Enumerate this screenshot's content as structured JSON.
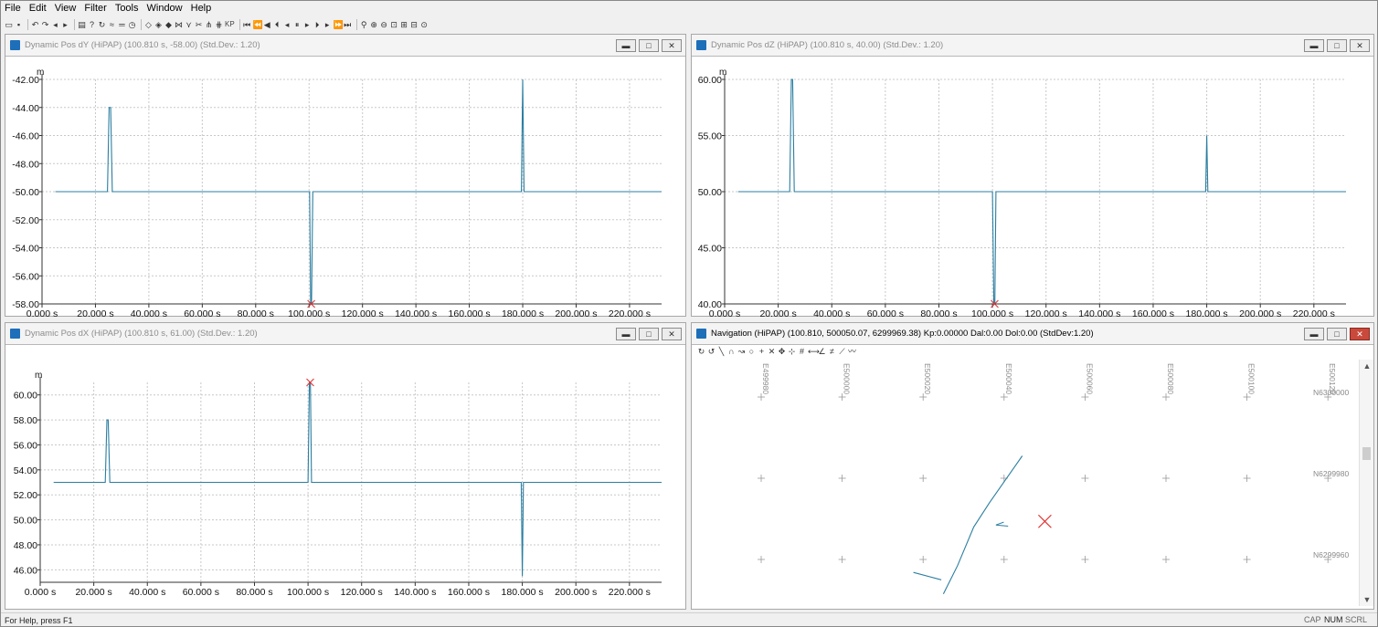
{
  "menu": [
    "File",
    "Edit",
    "View",
    "Filter",
    "Tools",
    "Window",
    "Help"
  ],
  "toolbar": {
    "icons": [
      "open-icon",
      "save-icon",
      "undo-icon",
      "redo-icon",
      "back-icon",
      "forward-icon",
      "print-icon",
      "help-icon",
      "refresh-icon",
      "filter-icon",
      "line-icon",
      "clock-icon",
      "marker-icon",
      "marker2-icon",
      "marker3-icon",
      "split-icon",
      "merge-icon",
      "cut-icon",
      "join-icon",
      "join2-icon"
    ],
    "kp_label": "KP",
    "playback_icons": [
      "first-icon",
      "rewind-fast-icon",
      "rewind-icon",
      "step-back-icon",
      "prev-icon",
      "pause-icon",
      "next-icon",
      "step-forward-icon",
      "forward-icon",
      "forward-fast-icon",
      "last-icon"
    ],
    "zoom_icons": [
      "zoom-icon",
      "zoom-in-icon",
      "zoom-out-icon",
      "zoom-fit-icon",
      "zoom-all-icon",
      "zoom-window-icon",
      "zoom-reset-icon"
    ]
  },
  "windows": {
    "dy": {
      "title": "Dynamic Pos dY (HiPAP) (100.810 s, -58.00)  (Std.Dev.: 1.20)",
      "unit": "m",
      "chart_data": {
        "type": "line",
        "title": "Dynamic Pos dY (HiPAP)",
        "xlabel": "",
        "ylabel": "m",
        "x_ticks": [
          "0.000 s",
          "20.000 s",
          "40.000 s",
          "60.000 s",
          "80.000 s",
          "100.000 s",
          "120.000 s",
          "140.000 s",
          "160.000 s",
          "180.000 s",
          "200.000 s",
          "220.000 s"
        ],
        "y_ticks": [
          "-42.00",
          "-44.00",
          "-46.00",
          "-48.00",
          "-50.00",
          "-52.00",
          "-54.00",
          "-56.00",
          "-58.00"
        ],
        "xlim": [
          0,
          232
        ],
        "ylim": [
          -58,
          -42
        ],
        "series": [
          {
            "x": [
              5,
              24.5,
              25.1,
              25.7,
              26.3,
              100.2,
              100.6,
              100.9,
              101.4,
              179.5,
              180.0,
              180.5,
              232
            ],
            "y": [
              -50,
              -50,
              -44,
              -44,
              -50,
              -50,
              -58,
              -58,
              -50,
              -50,
              -42,
              -50,
              -50
            ]
          }
        ],
        "cursor": {
          "x": 100.81,
          "y": -58.0
        }
      }
    },
    "dz": {
      "title": "Dynamic Pos dZ (HiPAP) (100.810 s, 40.00)  (Std.Dev.: 1.20)",
      "unit": "m",
      "chart_data": {
        "type": "line",
        "title": "Dynamic Pos dZ (HiPAP)",
        "xlabel": "",
        "ylabel": "m",
        "x_ticks": [
          "0.000 s",
          "20.000 s",
          "40.000 s",
          "60.000 s",
          "80.000 s",
          "100.000 s",
          "120.000 s",
          "140.000 s",
          "160.000 s",
          "180.000 s",
          "200.000 s",
          "220.000 s"
        ],
        "y_ticks": [
          "60.00",
          "55.00",
          "50.00",
          "45.00",
          "40.00"
        ],
        "xlim": [
          0,
          232
        ],
        "ylim": [
          40,
          60
        ],
        "series": [
          {
            "x": [
              5,
              24.3,
              24.9,
              25.4,
              26.0,
              100.0,
              100.5,
              100.9,
              101.3,
              179.6,
              180.0,
              180.4,
              232
            ],
            "y": [
              50,
              50,
              60,
              60,
              50,
              50,
              40,
              40,
              50,
              50,
              55,
              50,
              50
            ]
          }
        ],
        "cursor": {
          "x": 100.81,
          "y": 40.0
        }
      }
    },
    "dx": {
      "title": "Dynamic Pos dX (HiPAP) (100.810 s, 61.00)  (Std.Dev.: 1.20)",
      "unit": "m",
      "chart_data": {
        "type": "line",
        "title": "Dynamic Pos dX (HiPAP)",
        "xlabel": "",
        "ylabel": "m",
        "x_ticks": [
          "0.000 s",
          "20.000 s",
          "40.000 s",
          "60.000 s",
          "80.000 s",
          "100.000 s",
          "120.000 s",
          "140.000 s",
          "160.000 s",
          "180.000 s",
          "200.000 s",
          "220.000 s"
        ],
        "y_ticks": [
          "60.00",
          "58.00",
          "56.00",
          "54.00",
          "52.00",
          "50.00",
          "48.00",
          "46.00"
        ],
        "xlim": [
          0,
          232
        ],
        "ylim": [
          45,
          61
        ],
        "series": [
          {
            "x": [
              5,
              24.3,
              24.9,
              25.4,
              26.0,
              100.0,
              100.5,
              100.9,
              101.3,
              179.6,
              180.0,
              180.4,
              232
            ],
            "y": [
              53,
              53,
              58,
              58,
              53,
              53,
              61,
              61,
              53,
              53,
              45.5,
              53,
              53
            ]
          }
        ],
        "cursor": {
          "x": 100.81,
          "y": 61.0
        }
      }
    },
    "nav": {
      "title": "Navigation (HiPAP)    (100.810, 500050.07, 6299969.38)  Kp:0.00000 Dal:0.00 Dol:0.00  (StdDev:1.20)",
      "toolbar_icons": [
        "rotate-cw-icon",
        "rotate-ccw-icon",
        "line-tool-icon",
        "arc-tool-icon",
        "path-tool-icon",
        "node-icon",
        "add-node-icon",
        "delete-node-icon",
        "move-node-icon",
        "snap-icon",
        "grid-icon",
        "measure-icon",
        "angle-icon",
        "offset-icon",
        "profile-icon",
        "trend-icon"
      ],
      "easting_labels": [
        "E499980",
        "E500000",
        "E500020",
        "E500040",
        "E500060",
        "E500080",
        "E500100",
        "E500120"
      ],
      "northing_labels": [
        "N6300000",
        "N6299980",
        "N6299960"
      ],
      "track": {
        "e": [
          500044.5,
          500036.4,
          500032.5,
          500028.5,
          500025.0
        ],
        "n": [
          6299985.5,
          6299974.0,
          6299968.0,
          6299958.5,
          6299951.5
        ],
        "branch_e": [
          500039.9,
          500038.0,
          500041.0
        ],
        "branch_n": [
          6299969.2,
          6299968.5,
          6299968.2
        ],
        "tail_e": [
          500017.6,
          500024.5
        ],
        "tail_n": [
          6299956.8,
          6299955.0
        ],
        "cursor": {
          "e": 500050.07,
          "n": 6299969.38
        }
      }
    }
  },
  "status": {
    "help_text": "For Help, press F1",
    "indicators": [
      "CAP",
      "NUM",
      "SCRL"
    ]
  }
}
